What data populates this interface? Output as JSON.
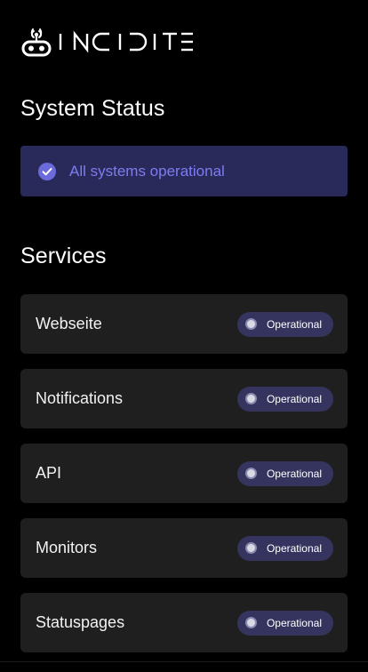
{
  "brand": {
    "name": "INCIDITE",
    "logo_icon": "robot-antenna-icon"
  },
  "system": {
    "title": "System Status",
    "status_text": "All systems operational",
    "status_icon": "check-circle-icon",
    "accent_color": "#6c6bdc"
  },
  "services": {
    "title": "Services",
    "items": [
      {
        "name": "Webseite",
        "status": "Operational"
      },
      {
        "name": "Notifications",
        "status": "Operational"
      },
      {
        "name": "API",
        "status": "Operational"
      },
      {
        "name": "Monitors",
        "status": "Operational"
      },
      {
        "name": "Statuspages",
        "status": "Operational"
      }
    ]
  }
}
